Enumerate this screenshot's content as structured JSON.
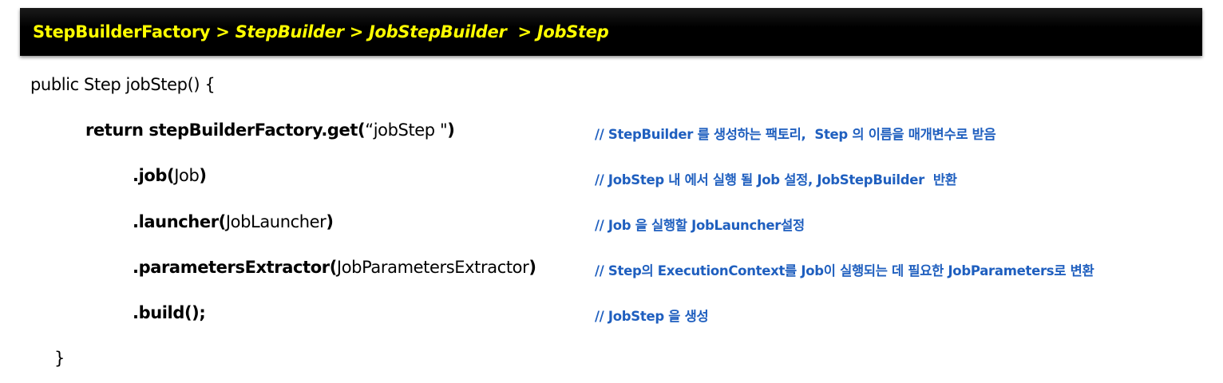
{
  "header": {
    "part1": "StepBuilderFactory",
    "part2": " > StepBuilder > JobStepBuilder  > JobStep"
  },
  "code": {
    "line1": "public Step jobStep() {",
    "line2_kw": "return stepBuilderFactory.get(",
    "line2_arg": "“jobStep \"",
    "line2_end": ")",
    "line3_kw": ".job(",
    "line3_arg": "Job",
    "line3_end": ")",
    "line4_kw": ".launcher(",
    "line4_arg": "JobLauncher",
    "line4_end": ")",
    "line5_kw": ".parametersExtractor(",
    "line5_arg": "JobParametersExtractor",
    "line5_end": ")",
    "line6": ".build();",
    "line7": "}"
  },
  "comments": {
    "c2": "// StepBuilder 를 생성하는 팩토리,  Step 의 이름을 매개변수로 받음",
    "c3": "// JobStep 내 에서 실행 될 Job 설정, JobStepBuilder  반환",
    "c4": "// Job 을 실행할 JobLauncher설정",
    "c5": "// Step의 ExecutionContext를 Job이 실행되는 데 필요한 JobParameters로 변환",
    "c6": "// JobStep 을 생성"
  },
  "colors": {
    "header_bg": "#000000",
    "header_text": "#ffff00",
    "comment": "#1f5fbf",
    "code": "#000000"
  }
}
